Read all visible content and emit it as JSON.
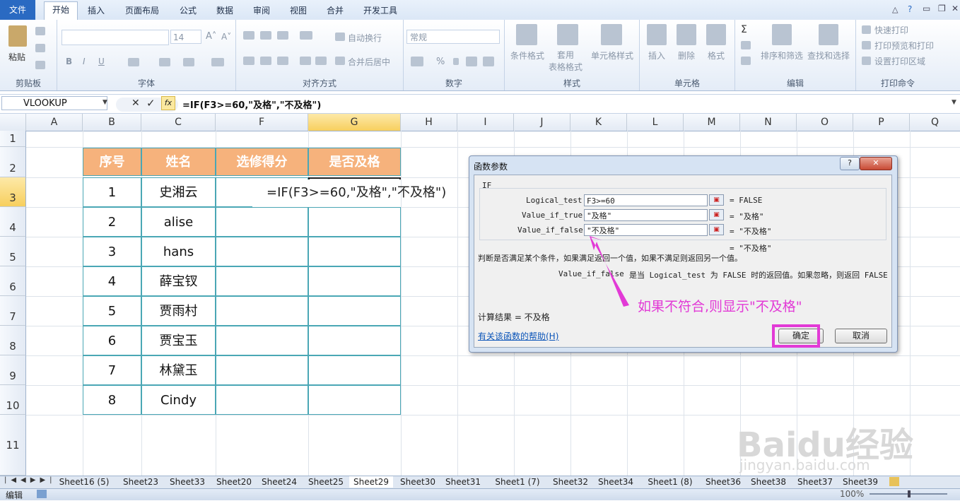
{
  "ribbon": {
    "tabs": [
      "文件",
      "开始",
      "插入",
      "页面布局",
      "公式",
      "数据",
      "审阅",
      "视图",
      "合并",
      "开发工具"
    ],
    "font_size": "14",
    "groups": [
      "剪贴板",
      "字体",
      "对齐方式",
      "数字",
      "样式",
      "单元格",
      "编辑",
      "打印命令"
    ],
    "paste": "粘贴",
    "wrap_text": "自动换行",
    "merge_center": "合并后居中",
    "number_format": "常规",
    "conditional_format": "条件格式",
    "table_format": "套用\n表格格式",
    "cell_style": "单元格样式",
    "insert": "插入",
    "delete": "删除",
    "format": "格式",
    "sort_filter": "排序和筛选",
    "find_select": "查找和选择",
    "quick_print": "快速打印",
    "print_preview": "打印预览和打印",
    "set_print_area": "设置打印区域",
    "bold": "B",
    "italic": "I",
    "underline": "U",
    "percent": "%"
  },
  "formula_bar": {
    "name_box": "VLOOKUP",
    "fx": "fx",
    "formula": "=IF(F3>=60,\"及格\",\"不及格\")"
  },
  "grid": {
    "columns": [
      "A",
      "B",
      "C",
      "F",
      "G",
      "H",
      "I",
      "J",
      "K",
      "L",
      "M",
      "N",
      "O",
      "P",
      "Q"
    ],
    "rows": [
      "1",
      "2",
      "3",
      "4",
      "5",
      "6",
      "7",
      "8",
      "9",
      "10",
      "11"
    ]
  },
  "table": {
    "headers": [
      "序号",
      "姓名",
      "选修得分",
      "是否及格"
    ],
    "rows": [
      [
        "1",
        "史湘云"
      ],
      [
        "2",
        "alise"
      ],
      [
        "3",
        "hans"
      ],
      [
        "4",
        "薛宝钗"
      ],
      [
        "5",
        "贾雨村"
      ],
      [
        "6",
        "贾宝玉"
      ],
      [
        "7",
        "林黛玉"
      ],
      [
        "8",
        "Cindy"
      ]
    ],
    "cell_formula": "=IF(F3>=60,\"及格\",\"不及格\")"
  },
  "dialog": {
    "title": "函数参数",
    "function": "IF",
    "args": [
      {
        "label": "Logical_test",
        "value": "F3>=60",
        "result": "= FALSE"
      },
      {
        "label": "Value_if_true",
        "value": "\"及格\"",
        "result": "= \"及格\""
      },
      {
        "label": "Value_if_false",
        "value": "\"不及格\"",
        "result": "= \"不及格\""
      }
    ],
    "overall_result": "= \"不及格\"",
    "description": "判断是否满足某个条件，如果满足返回一个值，如果不满足则返回另一个值。",
    "arg_help_label": "Value_if_false",
    "arg_help": "是当 Logical_test 为 FALSE 时的返回值。如果忽略，则返回 FALSE",
    "calc_result": "计算结果 =  不及格",
    "help_link": "有关该函数的帮助(H)",
    "ok": "确定",
    "cancel": "取消",
    "help_btn": "?",
    "close_btn": "✕"
  },
  "annotation": {
    "text": "如果不符合,则显示\"不及格\"",
    "color": "#e23ad6"
  },
  "sheets": [
    "Sheet16 (5)",
    "Sheet23",
    "Sheet33",
    "Sheet20",
    "Sheet24",
    "Sheet25",
    "Sheet29",
    "Sheet30",
    "Sheet31",
    "Sheet1 (7)",
    "Sheet32",
    "Sheet34",
    "Sheet1 (8)",
    "Sheet36",
    "Sheet38",
    "Sheet37",
    "Sheet39"
  ],
  "active_sheet": "Sheet29",
  "status": {
    "mode": "编辑",
    "zoom": "100%"
  },
  "watermark": {
    "brand": "Baidu经验",
    "url": "jingyan.baidu.com"
  }
}
